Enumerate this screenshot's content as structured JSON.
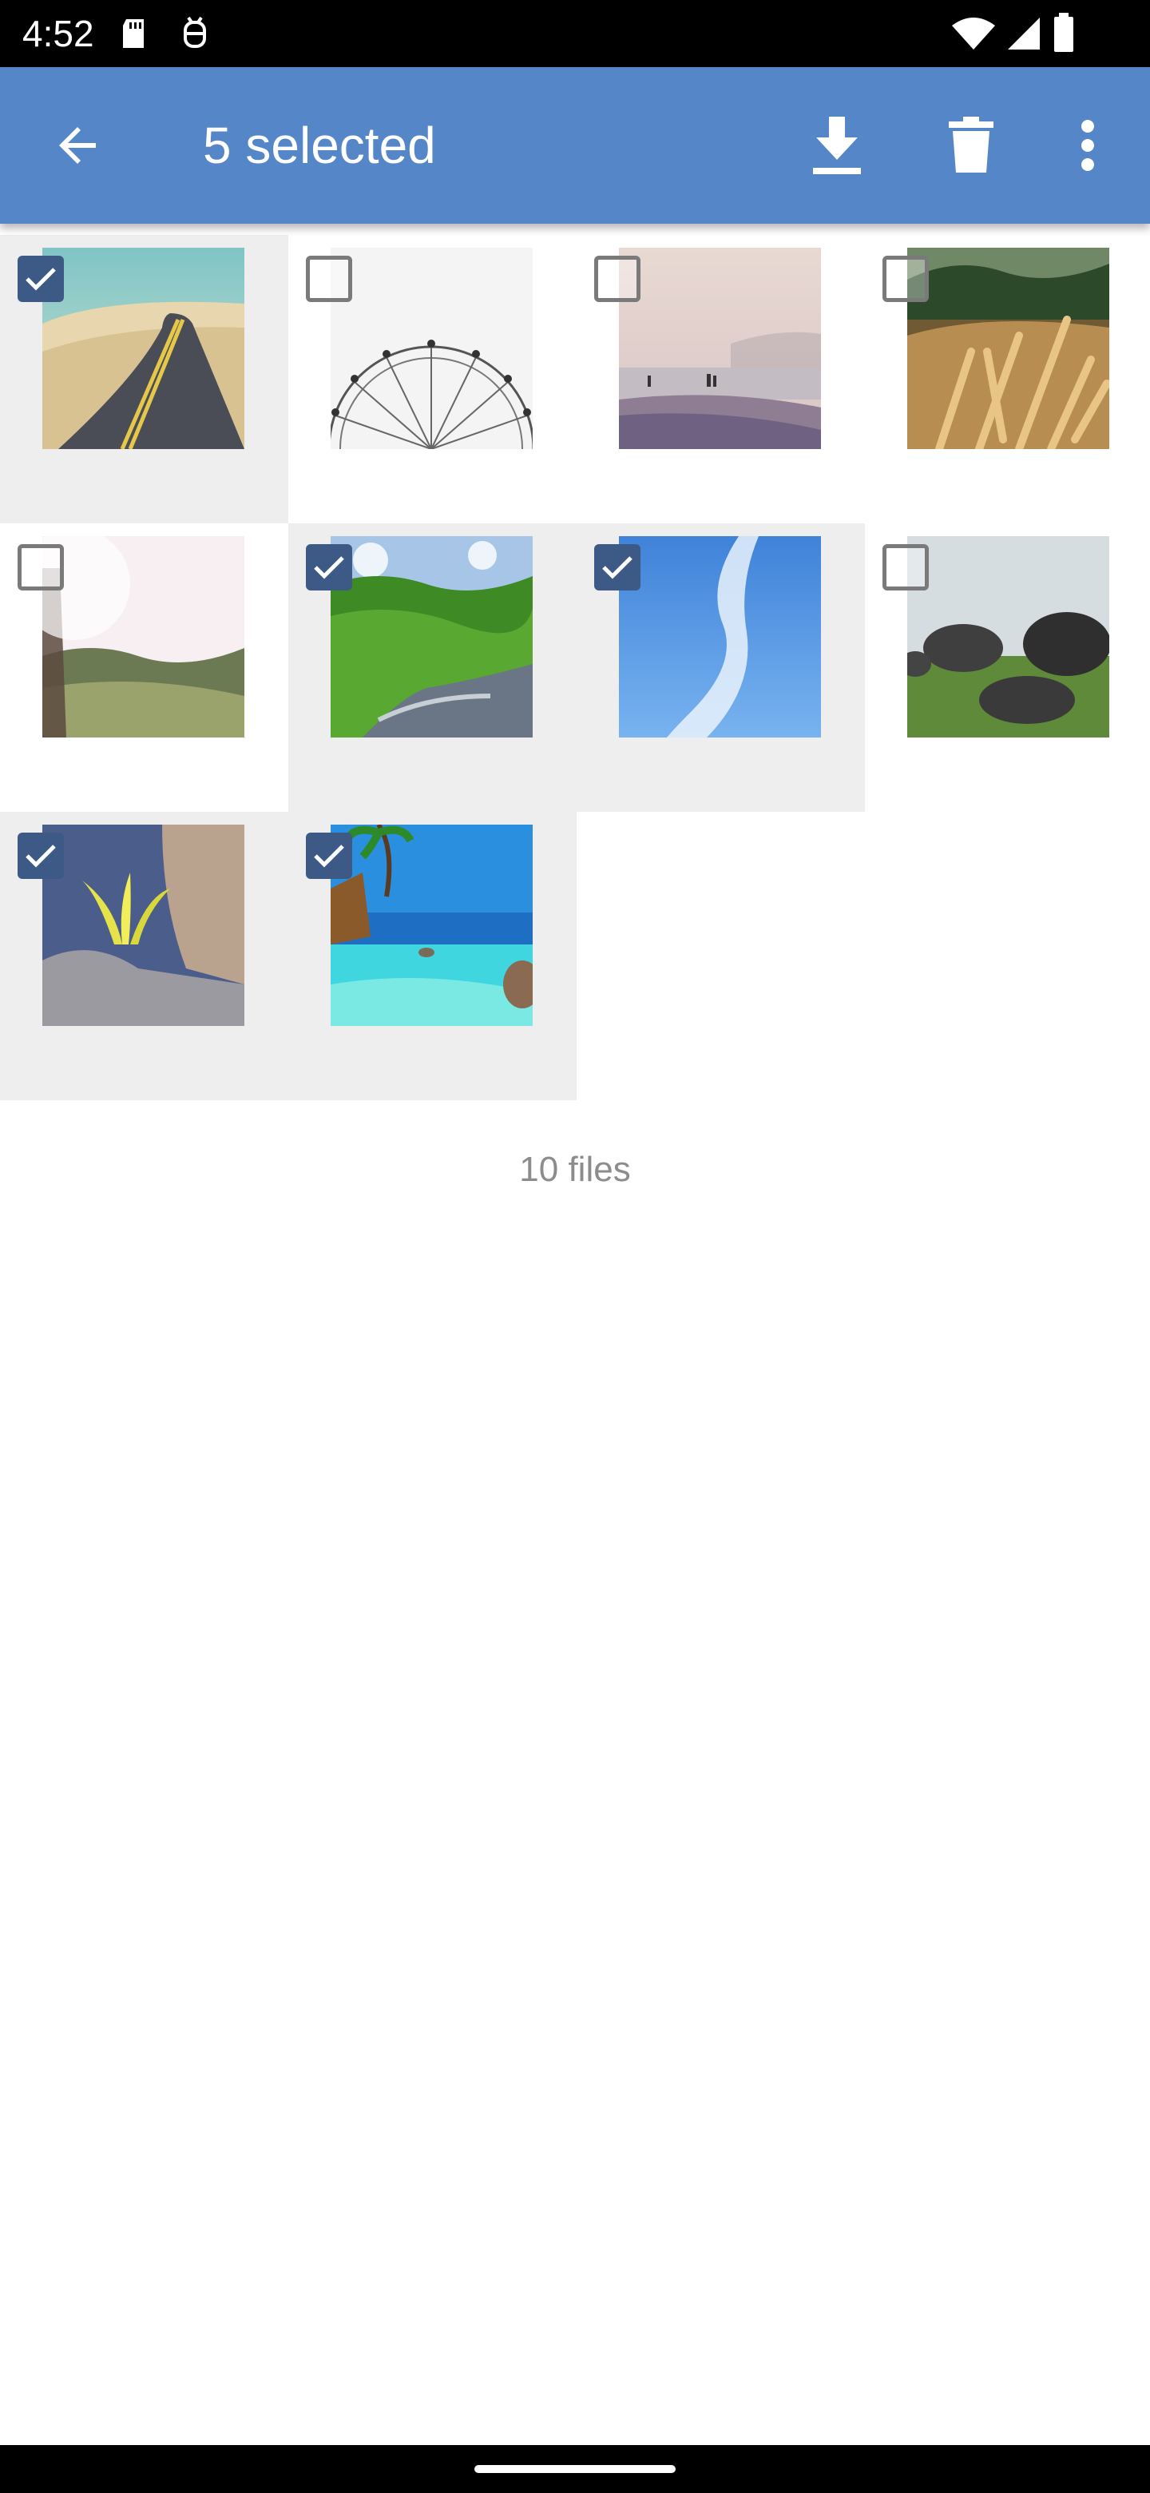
{
  "status_bar": {
    "time": "4:52"
  },
  "app_bar": {
    "title": "5 selected",
    "back_icon": "arrow-back-icon",
    "download_icon": "download-icon",
    "delete_icon": "trash-icon",
    "more_icon": "more-vert-icon",
    "background_color": "#5586c8"
  },
  "grid": {
    "items": [
      {
        "name": "road-photo",
        "selected": true
      },
      {
        "name": "ferris-wheel-photo",
        "selected": false
      },
      {
        "name": "beach-photo",
        "selected": false
      },
      {
        "name": "wheat-photo",
        "selected": false
      },
      {
        "name": "sunlight-photo",
        "selected": false
      },
      {
        "name": "forest-river-photo",
        "selected": true
      },
      {
        "name": "sky-cloud-photo",
        "selected": true
      },
      {
        "name": "rocks-photo",
        "selected": false
      },
      {
        "name": "plant-rock-photo",
        "selected": true
      },
      {
        "name": "tropical-pool-photo",
        "selected": true
      }
    ],
    "checked_color": "#3d5a86"
  },
  "footer": {
    "files_count": "10 files"
  }
}
